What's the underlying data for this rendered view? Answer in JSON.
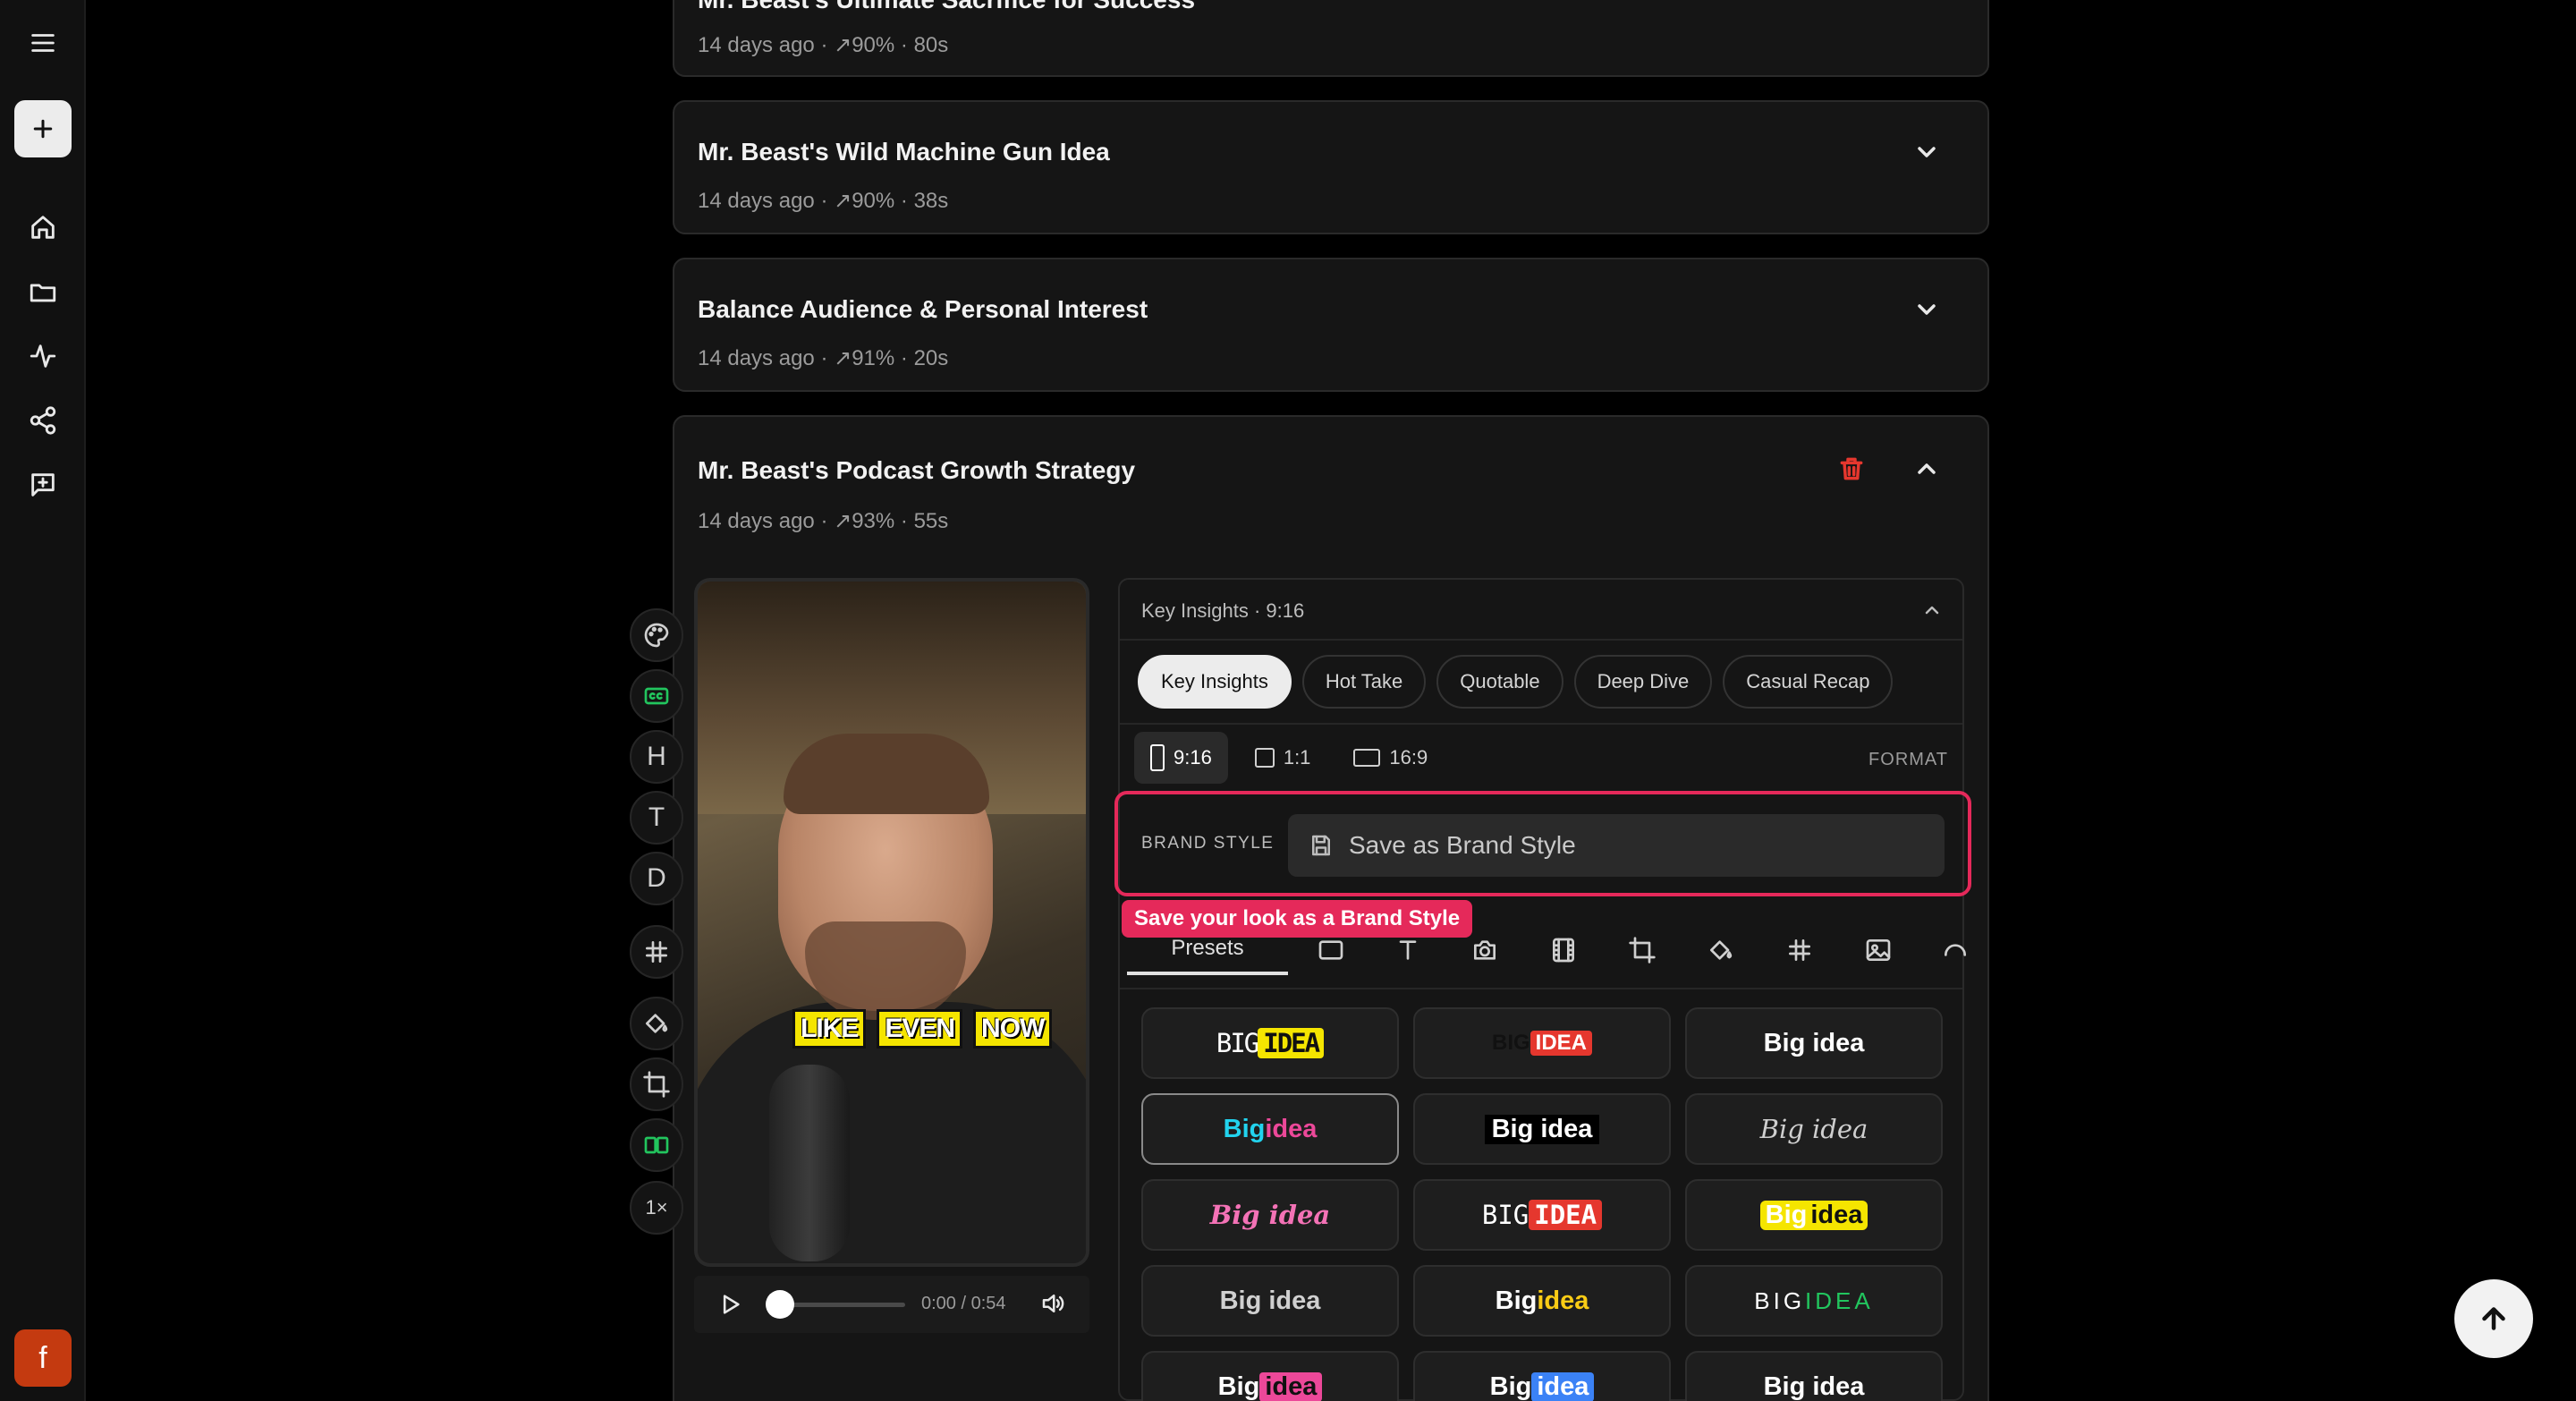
{
  "sidebar": {
    "new_label": "+",
    "avatar_letter": "f"
  },
  "cards": [
    {
      "title": "Mr. Beast's Ultimate Sacrifice for Success",
      "meta": "14 days ago · ↗90% · 80s"
    },
    {
      "title": "Mr. Beast's Wild Machine Gun Idea",
      "meta": "14 days ago · ↗90% · 38s"
    },
    {
      "title": "Balance Audience & Personal Interest",
      "meta": "14 days ago · ↗91% · 20s"
    },
    {
      "title": "Mr. Beast's Podcast Growth Strategy",
      "meta": "14 days ago · ↗93% · 55s"
    }
  ],
  "tools": {
    "h": "H",
    "t": "T",
    "d": "D",
    "speed": "1×"
  },
  "video": {
    "captions": [
      "LIKE",
      "EVEN",
      "NOW"
    ],
    "time": "0:00 / 0:54",
    "progress": 0
  },
  "panel": {
    "header": "Key Insights · 9:16",
    "tabs": [
      "Key Insights",
      "Hot Take",
      "Quotable",
      "Deep Dive",
      "Casual Recap"
    ],
    "formats": [
      "9:16",
      "1:1",
      "16:9"
    ],
    "format_label": "FORMAT",
    "brand_label": "BRAND STYLE",
    "brand_button": "Save as Brand Style",
    "tooltip": "Save your look as a Brand Style",
    "presets_tab": "Presets"
  },
  "presets": [
    {
      "a": "BIG ",
      "b": "IDEA"
    },
    {
      "a": "BIG ",
      "b": "IDEA"
    },
    {
      "a": "Big idea",
      "b": ""
    },
    {
      "a": "Big ",
      "b": "idea"
    },
    {
      "a": "Big idea",
      "b": ""
    },
    {
      "a": "Big idea",
      "b": ""
    },
    {
      "a": "Big idea",
      "b": ""
    },
    {
      "a": "BIG ",
      "b": "IDEA"
    },
    {
      "a": "Big ",
      "b": "idea"
    },
    {
      "a": "Big idea",
      "b": ""
    },
    {
      "a": "Big ",
      "b": "idea"
    },
    {
      "a": "BIG ",
      "b": "IDEA"
    },
    {
      "a": "Big ",
      "b": "idea"
    },
    {
      "a": "Big ",
      "b": "idea"
    },
    {
      "a": "Big idea",
      "b": ""
    }
  ],
  "colors": {
    "accent": "#e5295a",
    "caption": "#f5e500",
    "green": "#22c55e"
  }
}
